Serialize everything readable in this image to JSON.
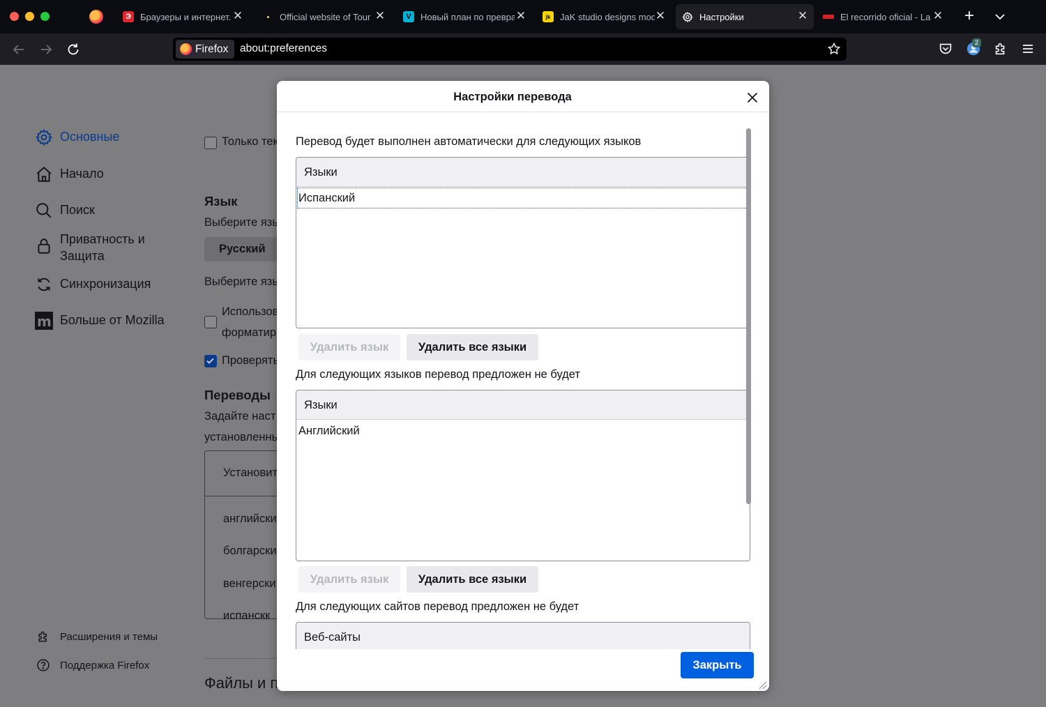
{
  "tabs": [
    {
      "title": "Браузеры и интернет.",
      "favicon": "red-news-icon"
    },
    {
      "title": "Official website of Tour",
      "favicon": "dot-icon"
    },
    {
      "title": "Новый план по превра",
      "favicon": "v-logo-icon"
    },
    {
      "title": "JaK studio designs mod",
      "favicon": "jak-logo-icon"
    },
    {
      "title": "Настройки",
      "favicon": "gear-icon",
      "active": true
    },
    {
      "title": "El recorrido oficial - La",
      "favicon": "flag-icon"
    }
  ],
  "urlbar": {
    "identity_label": "Firefox",
    "url": "about:preferences",
    "extension_badge": "2"
  },
  "sidebar": {
    "items": [
      {
        "label": "Основные",
        "icon": "gear-icon",
        "active": true
      },
      {
        "label": "Начало",
        "icon": "home-icon"
      },
      {
        "label": "Поиск",
        "icon": "search-icon"
      },
      {
        "label": "Приватность и Защита",
        "icon": "lock-icon"
      },
      {
        "label": "Синхронизация",
        "icon": "sync-icon"
      },
      {
        "label": "Больше от Mozilla",
        "icon": "mozilla-icon"
      }
    ],
    "footer": [
      {
        "label": "Расширения и темы",
        "icon": "puzzle-icon"
      },
      {
        "label": "Поддержка Firefox",
        "icon": "help-icon"
      }
    ]
  },
  "page": {
    "text_only_checkbox": "Только тек",
    "language_heading": "Язык",
    "choose_lang_1": "Выберите язы",
    "lang_button": "Русский",
    "choose_lang_2": "Выберите язы",
    "use_line1": "Использов",
    "use_line2": "форматир",
    "check_line": "Проверять",
    "translations_heading": "Переводы",
    "translations_desc1": "Задайте наст",
    "translations_desc2": "установленны",
    "table_header": "Установит",
    "table_rows": [
      "английски",
      "болгарски",
      "венгерски",
      "испанскк"
    ],
    "files_heading": "Файлы и п"
  },
  "dialog": {
    "title": "Настройки перевода",
    "always_label": "Перевод будет выполнен автоматически для следующих языков",
    "always_header": "Языки",
    "always_items": [
      "Испанский"
    ],
    "remove_lang": "Удалить язык",
    "remove_all": "Удалить все языки",
    "never_label": "Для следующих языков перевод предложен не будет",
    "never_header": "Языки",
    "never_items": [
      "Английский"
    ],
    "remove_lang2": "Удалить язык",
    "remove_all2": "Удалить все языки",
    "sites_label": "Для следующих сайтов перевод предложен не будет",
    "sites_header": "Веб-сайты",
    "close_button": "Закрыть"
  }
}
